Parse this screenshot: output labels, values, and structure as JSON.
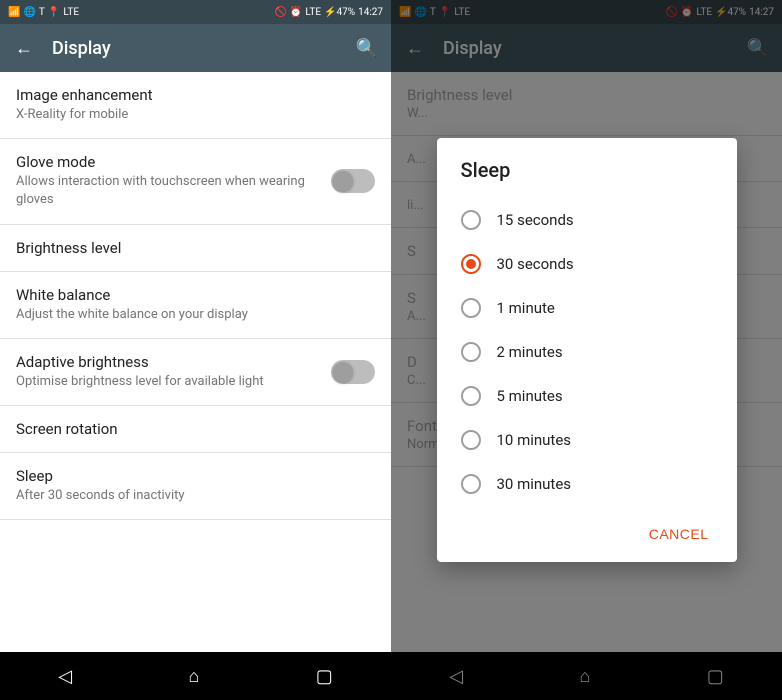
{
  "left_panel": {
    "status_bar": {
      "time": "14:27",
      "battery": "47%"
    },
    "toolbar": {
      "title": "Display",
      "back_icon": "←",
      "search_icon": "🔍"
    },
    "settings": [
      {
        "id": "image-enhancement",
        "title": "Image enhancement",
        "subtitle": "X-Reality for mobile",
        "has_toggle": false
      },
      {
        "id": "glove-mode",
        "title": "Glove mode",
        "subtitle": "Allows interaction with touchscreen when wearing gloves",
        "has_toggle": true,
        "toggle_on": false
      },
      {
        "id": "brightness-level",
        "title": "Brightness level",
        "subtitle": "",
        "has_toggle": false
      },
      {
        "id": "white-balance",
        "title": "White balance",
        "subtitle": "Adjust the white balance on your display",
        "has_toggle": false
      },
      {
        "id": "adaptive-brightness",
        "title": "Adaptive brightness",
        "subtitle": "Optimise brightness level for available light",
        "has_toggle": true,
        "toggle_on": false
      },
      {
        "id": "screen-rotation",
        "title": "Screen rotation",
        "subtitle": "",
        "has_toggle": false
      },
      {
        "id": "sleep",
        "title": "Sleep",
        "subtitle": "After 30 seconds of inactivity",
        "has_toggle": false
      }
    ],
    "nav": {
      "back": "◁",
      "home": "⌂",
      "recents": "▢"
    }
  },
  "right_panel": {
    "status_bar": {
      "time": "14:27",
      "battery": "47%"
    },
    "toolbar": {
      "title": "Display",
      "back_icon": "←",
      "search_icon": "🔍"
    },
    "bg_items": [
      {
        "title": "Brightness level",
        "subtitle": "W..."
      },
      {
        "title": "",
        "subtitle": "A..."
      },
      {
        "title": "",
        "subtitle": "li..."
      },
      {
        "title": "S",
        "subtitle": ""
      },
      {
        "title": "S",
        "subtitle": "A..."
      },
      {
        "title": "D",
        "subtitle": "C..."
      },
      {
        "title": "Font size",
        "subtitle": "Normal"
      }
    ],
    "dialog": {
      "title": "Sleep",
      "options": [
        {
          "label": "15 seconds",
          "selected": false
        },
        {
          "label": "30 seconds",
          "selected": true
        },
        {
          "label": "1 minute",
          "selected": false
        },
        {
          "label": "2 minutes",
          "selected": false
        },
        {
          "label": "5 minutes",
          "selected": false
        },
        {
          "label": "10 minutes",
          "selected": false
        },
        {
          "label": "30 minutes",
          "selected": false
        }
      ],
      "cancel_label": "CANCEL"
    },
    "nav": {
      "back": "◁",
      "home": "⌂",
      "recents": "▢"
    }
  }
}
